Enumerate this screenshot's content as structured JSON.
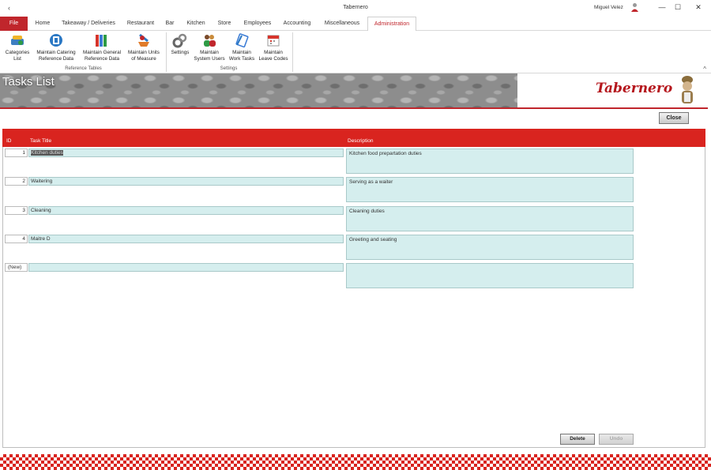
{
  "window": {
    "title": "Tabernero",
    "user": "Miguel Velez",
    "back_glyph": "‹",
    "min_glyph": "—",
    "max_glyph": "☐",
    "close_glyph": "✕"
  },
  "tabs": [
    "File",
    "Home",
    "Takeaway / Deliveries",
    "Restaurant",
    "Bar",
    "Kitchen",
    "Store",
    "Employees",
    "Accounting",
    "Miscellaneous",
    "Administration"
  ],
  "active_tab": "Administration",
  "ribbon": {
    "reference_tables": {
      "label": "Reference Tables",
      "buttons": [
        {
          "line1": "Categories",
          "line2": "List",
          "icon": "categories-icon"
        },
        {
          "line1": "Maintain Catering",
          "line2": "Reference Data",
          "icon": "catering-data-icon"
        },
        {
          "line1": "Maintain General",
          "line2": "Reference Data",
          "icon": "general-data-icon"
        },
        {
          "line1": "Maintain Units",
          "line2": "of Measure",
          "icon": "units-icon"
        }
      ]
    },
    "settings": {
      "label": "Settings",
      "buttons": [
        {
          "line1": "Settings",
          "line2": "",
          "icon": "settings-icon"
        },
        {
          "line1": "Maintain",
          "line2": "System Users",
          "icon": "users-icon"
        },
        {
          "line1": "Maintain",
          "line2": "Work Tasks",
          "icon": "tasks-icon"
        },
        {
          "line1": "Maintain",
          "line2": "Leave Codes",
          "icon": "calendar-icon"
        }
      ]
    },
    "collapse_glyph": "^"
  },
  "banner": {
    "page_title": "Tasks List",
    "logo": "Tabernero"
  },
  "close_label": "Close",
  "table": {
    "headers": {
      "id": "ID",
      "title": "Task Title",
      "description": "Description"
    },
    "rows": [
      {
        "id": "1",
        "title": "Kitchen duties",
        "description": "Kitchen food prepartation duties"
      },
      {
        "id": "2",
        "title": "Waitering",
        "description": "Serving as a waiter"
      },
      {
        "id": "3",
        "title": "Cleaning",
        "description": "Cleaning duties"
      },
      {
        "id": "4",
        "title": "Maitre D",
        "description": "Greeting and seating"
      }
    ],
    "new_row_label": "(New)"
  },
  "buttons": {
    "delete": "Delete",
    "undo": "Undo"
  },
  "colors": {
    "brand_red": "#d9241f",
    "field_bg": "#d5eeee"
  }
}
